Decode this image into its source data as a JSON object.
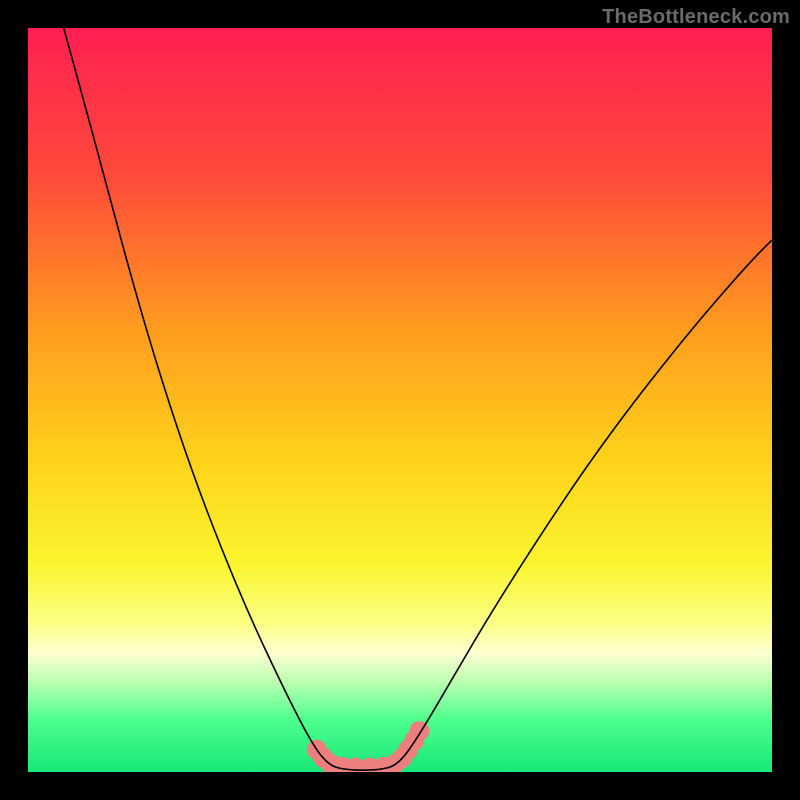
{
  "watermark": "TheBottleneck.com",
  "chart_data": {
    "type": "line",
    "title": "",
    "xlabel": "",
    "ylabel": "",
    "xlim": [
      0,
      100
    ],
    "ylim": [
      0,
      100
    ],
    "background_gradient": {
      "stops": [
        {
          "offset": 0.0,
          "color": "#ff1f52"
        },
        {
          "offset": 0.2,
          "color": "#ff4a3a"
        },
        {
          "offset": 0.4,
          "color": "#ff9a1f"
        },
        {
          "offset": 0.58,
          "color": "#ffd21a"
        },
        {
          "offset": 0.72,
          "color": "#faf52e"
        },
        {
          "offset": 0.8,
          "color": "#fbff84"
        },
        {
          "offset": 0.84,
          "color": "#fdffd0"
        },
        {
          "offset": 0.88,
          "color": "#b8ffb0"
        },
        {
          "offset": 0.93,
          "color": "#4dff8d"
        },
        {
          "offset": 1.0,
          "color": "#17e877"
        }
      ]
    },
    "series": [
      {
        "name": "curve",
        "stroke": "#000000",
        "stroke_width": 1.6,
        "points": [
          {
            "x": 4.8,
            "y": 100.0
          },
          {
            "x": 7.0,
            "y": 92.0
          },
          {
            "x": 10.0,
            "y": 81.0
          },
          {
            "x": 14.0,
            "y": 66.0
          },
          {
            "x": 18.0,
            "y": 52.5
          },
          {
            "x": 22.0,
            "y": 40.5
          },
          {
            "x": 26.0,
            "y": 30.0
          },
          {
            "x": 30.0,
            "y": 20.5
          },
          {
            "x": 34.0,
            "y": 12.0
          },
          {
            "x": 37.0,
            "y": 6.0
          },
          {
            "x": 39.0,
            "y": 2.6
          },
          {
            "x": 40.5,
            "y": 1.0
          },
          {
            "x": 42.0,
            "y": 0.4
          },
          {
            "x": 45.0,
            "y": 0.2
          },
          {
            "x": 48.0,
            "y": 0.4
          },
          {
            "x": 49.5,
            "y": 1.0
          },
          {
            "x": 51.0,
            "y": 2.6
          },
          {
            "x": 53.5,
            "y": 6.5
          },
          {
            "x": 57.0,
            "y": 12.5
          },
          {
            "x": 62.0,
            "y": 21.0
          },
          {
            "x": 68.0,
            "y": 30.5
          },
          {
            "x": 75.0,
            "y": 41.0
          },
          {
            "x": 82.0,
            "y": 50.5
          },
          {
            "x": 90.0,
            "y": 60.5
          },
          {
            "x": 97.0,
            "y": 68.5
          },
          {
            "x": 100.0,
            "y": 71.5
          }
        ]
      },
      {
        "name": "highlight-dots",
        "stroke": "#ed7f7f",
        "marker_radius": 10,
        "points": [
          {
            "x": 38.8,
            "y": 3.0
          },
          {
            "x": 39.7,
            "y": 1.9
          },
          {
            "x": 40.7,
            "y": 1.1
          },
          {
            "x": 42.2,
            "y": 0.7
          },
          {
            "x": 44.0,
            "y": 0.6
          },
          {
            "x": 46.0,
            "y": 0.6
          },
          {
            "x": 47.8,
            "y": 0.7
          },
          {
            "x": 49.3,
            "y": 1.1
          },
          {
            "x": 50.3,
            "y": 1.9
          },
          {
            "x": 51.1,
            "y": 3.0
          },
          {
            "x": 51.9,
            "y": 4.2
          },
          {
            "x": 52.6,
            "y": 5.5
          }
        ]
      }
    ]
  }
}
